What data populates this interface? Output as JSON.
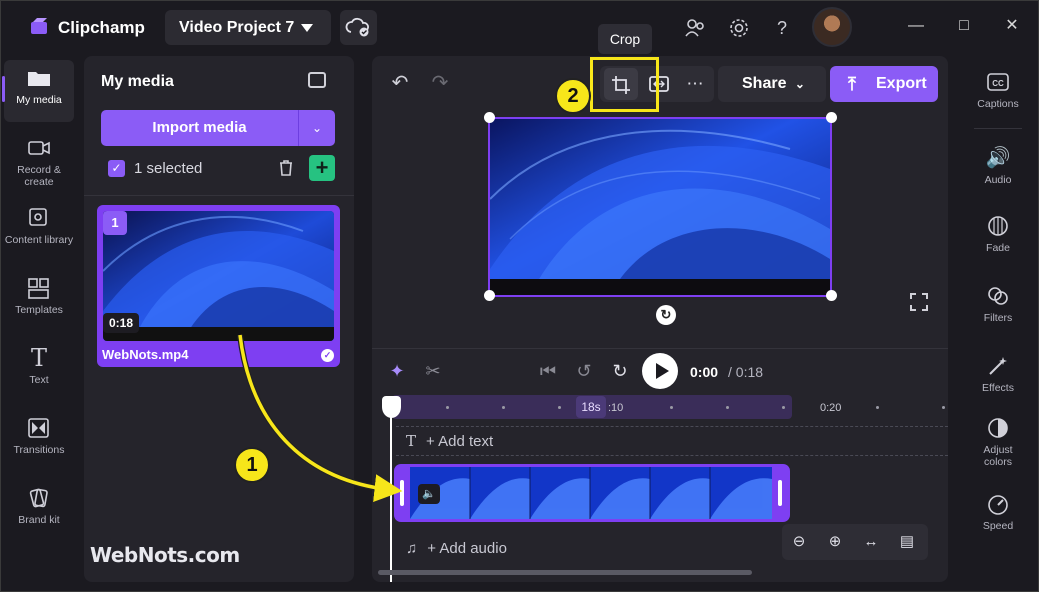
{
  "titlebar": {
    "app_name": "Clipchamp",
    "project_name": "Video Project 7"
  },
  "leftnav": {
    "items": [
      {
        "label": "My media",
        "icon": "folder-icon"
      },
      {
        "label": "Record & create",
        "icon": "camera-icon"
      },
      {
        "label": "Content library",
        "icon": "library-icon"
      },
      {
        "label": "Templates",
        "icon": "templates-icon"
      },
      {
        "label": "Text",
        "icon": "text-icon"
      },
      {
        "label": "Transitions",
        "icon": "transitions-icon"
      },
      {
        "label": "Brand kit",
        "icon": "brand-kit-icon"
      }
    ]
  },
  "media": {
    "title": "My media",
    "import_label": "Import media",
    "selected_label": "1 selected",
    "card": {
      "badge": "1",
      "duration": "0:18",
      "file_name": "WebNots.mp4"
    }
  },
  "editor": {
    "share_label": "Share",
    "export_label": "Export",
    "tooltip": "Crop",
    "time_current": "0:00",
    "time_total": "/ 0:18",
    "ruler_badge": "18s",
    "ruler_label_10": ":10",
    "ruler_label_20": "0:20",
    "add_text": "+ Add text",
    "add_audio": "+ Add audio"
  },
  "rightnav": {
    "items": [
      {
        "label": "Captions",
        "icon": "captions-icon"
      },
      {
        "label": "Audio",
        "icon": "audio-icon"
      },
      {
        "label": "Fade",
        "icon": "fade-icon"
      },
      {
        "label": "Filters",
        "icon": "filters-icon"
      },
      {
        "label": "Effects",
        "icon": "effects-icon"
      },
      {
        "label": "Adjust colors",
        "icon": "adjust-colors-icon"
      },
      {
        "label": "Speed",
        "icon": "speed-icon"
      }
    ]
  },
  "annotations": {
    "step1": "1",
    "step2": "2",
    "watermark": "WebNots.com"
  },
  "colors": {
    "accent": "#8b5cf6",
    "background": "#1b1a20",
    "panel": "#25242b",
    "annotation_yellow": "#f7e61a",
    "add_green": "#26c281"
  }
}
